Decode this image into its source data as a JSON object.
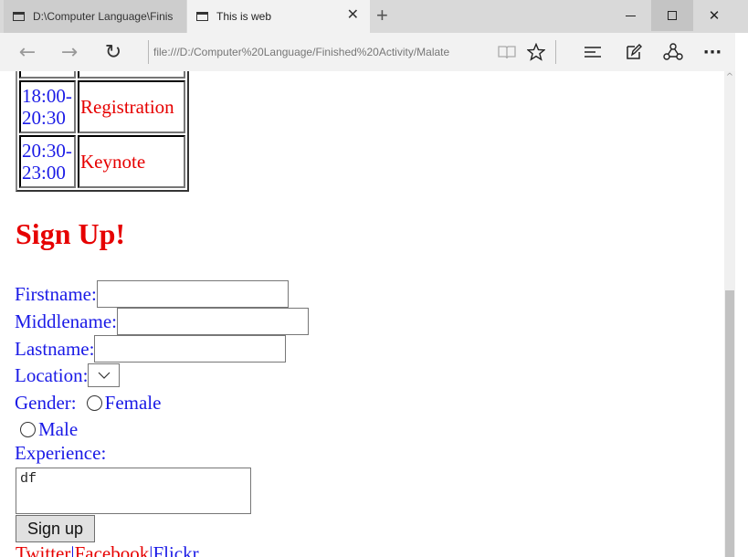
{
  "browser": {
    "tabs": [
      {
        "title": "D:\\Computer Language\\Finis",
        "active": false
      },
      {
        "title": "This is web",
        "active": true
      }
    ],
    "new_tab_label": "+",
    "address": "file:///D:/Computer%20Language/Finished%20Activity/Malate",
    "icons": [
      "back-arrow-icon",
      "forward-arrow-icon",
      "refresh-icon",
      "reading-view-icon",
      "favorite-star-icon",
      "hub-icon",
      "web-note-icon",
      "share-icon",
      "more-icon"
    ],
    "close_glyph": "✕",
    "refresh_glyph": "↻",
    "back_glyph": "←",
    "forward_glyph": "→",
    "more_glyph": "···"
  },
  "schedule": {
    "rows": [
      {
        "time": "18:00-20:30",
        "event": "Registration"
      },
      {
        "time": "20:30-23:00",
        "event": "Keynote"
      }
    ]
  },
  "signup": {
    "title": "Sign Up!",
    "firstname_label": "Firstname:",
    "middlename_label": "Middlename:",
    "lastname_label": "Lastname:",
    "location_label": "Location:",
    "gender_label": "Gender:",
    "female_label": "Female",
    "male_label": "Male",
    "experience_label": "Experience:",
    "experience_value": "df",
    "submit_label": "Sign up"
  },
  "links": [
    "Twitter",
    "Facebook",
    "Flickr"
  ],
  "link_separator": "|",
  "colors": {
    "blue_text": "#1a1ae6",
    "red_text": "#e60000"
  }
}
